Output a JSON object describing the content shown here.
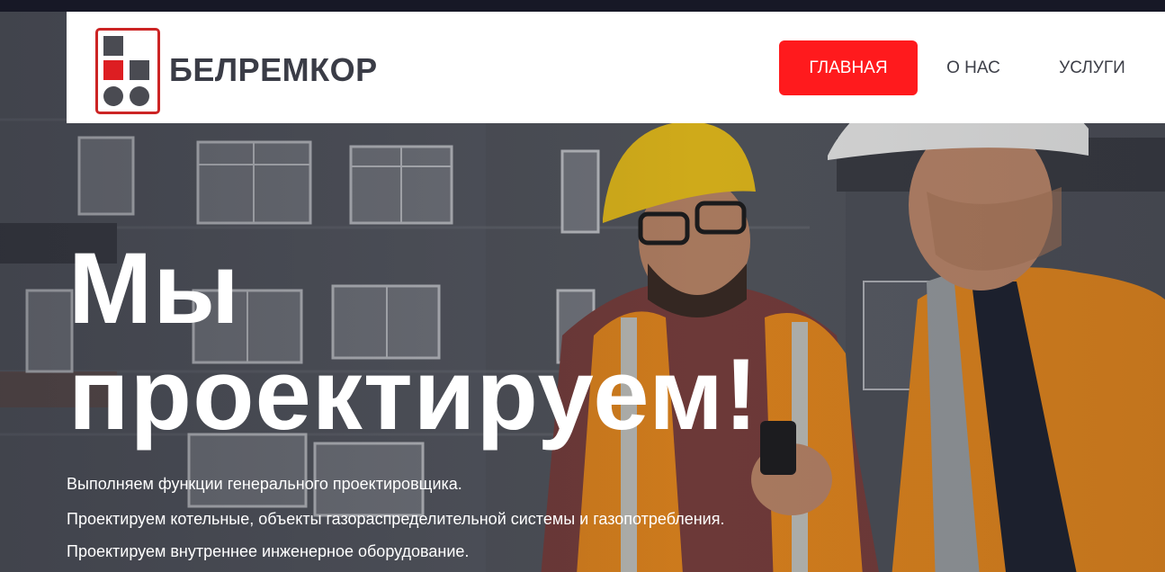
{
  "header": {
    "brand": "БЕЛРЕМКОР",
    "logo_icon": "belremkor-logo-icon",
    "nav": [
      {
        "label": "ГЛАВНАЯ",
        "active": true
      },
      {
        "label": "О НАС",
        "active": false
      },
      {
        "label": "УСЛУГИ",
        "active": false
      }
    ]
  },
  "hero": {
    "headline_line1": "Мы",
    "headline_line2": "проектируем!",
    "lines": [
      "Выполняем функции генерального проектировщика.",
      "Проектируем котельные, объекты газораспределительной системы и газопотребления.",
      "Проектируем внутреннее инженерное оборудование."
    ]
  },
  "colors": {
    "accent": "#ff1a1d",
    "logo_red": "#cc2424",
    "logo_gray": "#4a4b52",
    "text_dark": "#3a3c46"
  }
}
